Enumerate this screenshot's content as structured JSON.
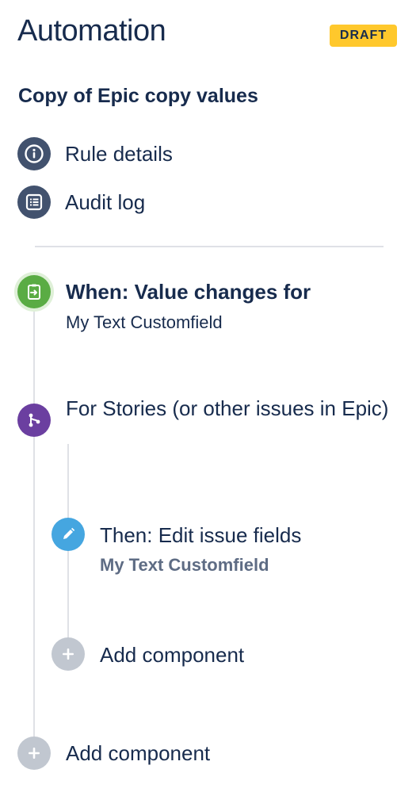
{
  "header": {
    "title": "Automation",
    "badge": "DRAFT",
    "rule_name": "Copy of Epic copy values"
  },
  "nav": {
    "items": [
      {
        "label": "Rule details",
        "icon": "info-icon"
      },
      {
        "label": "Audit log",
        "icon": "list-icon"
      }
    ]
  },
  "flow": {
    "trigger": {
      "title": "When: Value changes for",
      "subtitle": "My Text Customfield",
      "icon": "trigger-icon",
      "color": "#5aac44"
    },
    "branch": {
      "title": "For Stories (or other issues in Epic)",
      "icon": "branch-icon",
      "color": "#6b3fa0"
    },
    "action": {
      "title": "Then: Edit issue fields",
      "subtitle": "My Text Customfield",
      "icon": "pencil-icon",
      "color": "#45a6e0"
    },
    "add_component_inner": "Add component",
    "add_component_outer": "Add component"
  },
  "colors": {
    "badge": "#ffc82c",
    "nav_icon": "#42526e",
    "add_icon": "#c1c7d0",
    "text": "#172b4d"
  }
}
